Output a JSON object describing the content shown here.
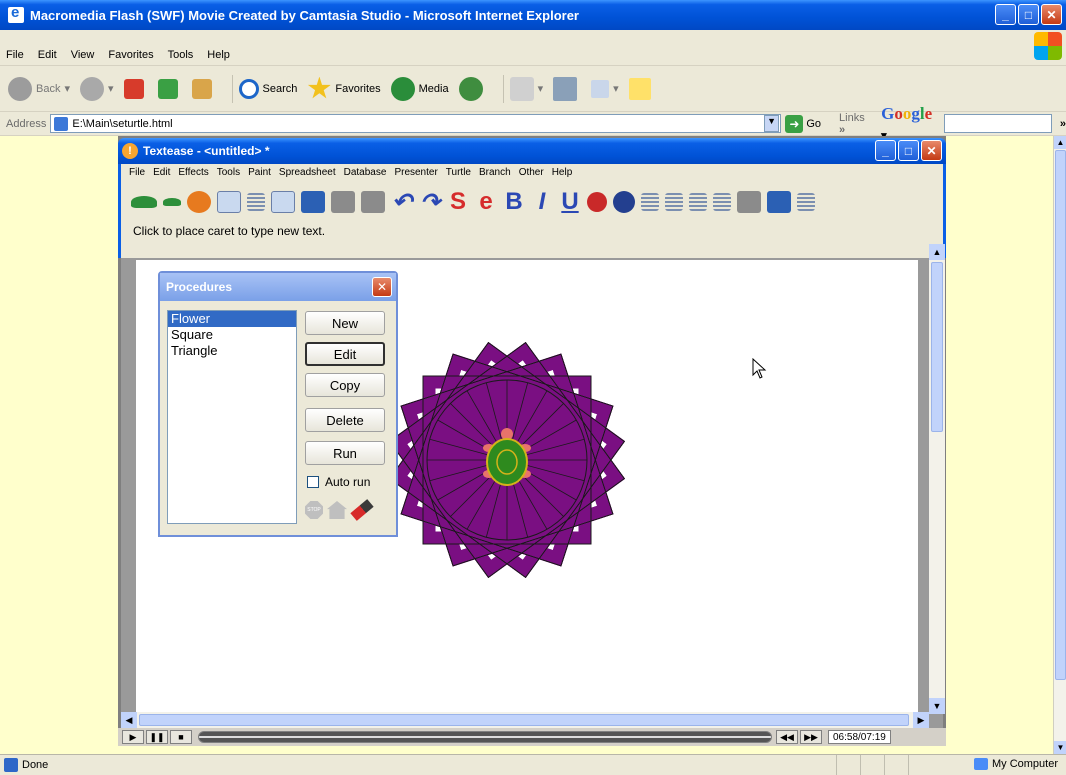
{
  "browser": {
    "title": "Macromedia Flash (SWF) Movie Created by Camtasia Studio - Microsoft Internet Explorer",
    "menu": [
      "File",
      "Edit",
      "View",
      "Favorites",
      "Tools",
      "Help"
    ],
    "toolbar": {
      "back": "Back",
      "search": "Search",
      "favorites": "Favorites",
      "media": "Media"
    },
    "address_label": "Address",
    "address_value": "E:\\Main\\seturtle.html",
    "go_label": "Go",
    "links_label": "Links",
    "google_letters": [
      "G",
      "o",
      "o",
      "g",
      "l",
      "e"
    ],
    "status_text": "Done",
    "zone_text": "My Computer"
  },
  "textease": {
    "title": "Textease - <untitled> *",
    "menu": [
      "File",
      "Edit",
      "Effects",
      "Tools",
      "Paint",
      "Spreadsheet",
      "Database",
      "Presenter",
      "Turtle",
      "Branch",
      "Other",
      "Help"
    ],
    "status_hint": "Click to place caret to type new text."
  },
  "procedures": {
    "title": "Procedures",
    "items": [
      "Flower",
      "Square",
      "Triangle"
    ],
    "selected_index": 0,
    "buttons": {
      "new": "New",
      "edit": "Edit",
      "copy": "Copy",
      "delete": "Delete",
      "run": "Run"
    },
    "auto_run_label": "Auto run",
    "auto_run_checked": false
  },
  "player": {
    "time": "06:58/07:19"
  },
  "colors": {
    "flower_purple": "#7a0f82",
    "turtle_green": "#2e8a1e",
    "xp_blue": "#0a5fe6",
    "page_bg": "#ffffcc"
  }
}
